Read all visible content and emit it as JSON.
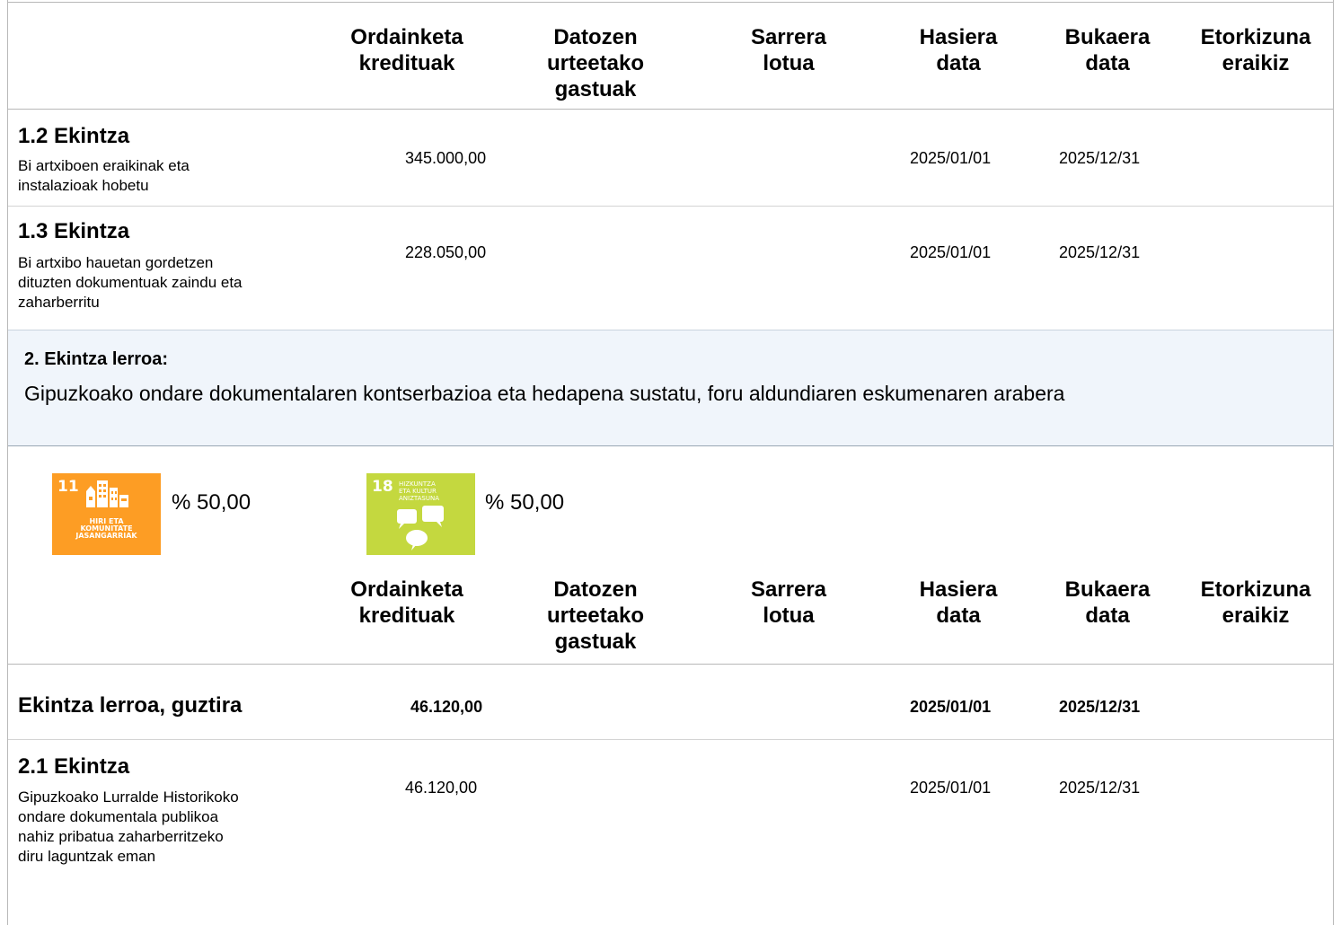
{
  "columns": [
    [
      "Ordainketa",
      "kredituak"
    ],
    [
      "Datozen",
      "urteetako",
      "gastuak"
    ],
    [
      "Sarrera",
      "lotua"
    ],
    [
      "Hasiera",
      "data"
    ],
    [
      "Bukaera",
      "data"
    ],
    [
      "Etorkizuna",
      "eraikiz"
    ]
  ],
  "rows_top": [
    {
      "title": "1.2 Ekintza",
      "desc": [
        "Bi artxiboen eraikinak eta",
        "instalazioak hobetu"
      ],
      "credit": "345.000,00",
      "start": "2025/01/01",
      "end": "2025/12/31"
    },
    {
      "title": "1.3 Ekintza",
      "desc": [
        "Bi artxibo hauetan gordetzen",
        "dituzten dokumentuak  zaindu eta",
        "zaharberritu"
      ],
      "credit": "228.050,00",
      "start": "2025/01/01",
      "end": "2025/12/31"
    }
  ],
  "section": {
    "heading": "2. Ekintza lerroa:",
    "text": "Gipuzkoako ondare dokumentalaren kontserbazioa eta hedapena sustatu, foru aldundiaren eskumenaren arabera"
  },
  "sdgs": [
    {
      "number": "11",
      "label": [
        "HIRI ETA",
        "KOMUNITATE",
        "JASANGARRIAK"
      ],
      "icon": "city-buildings-icon",
      "color": "#fd9d24",
      "percent": "% 50,00"
    },
    {
      "number": "18",
      "label": [
        "HIZKUNTZA",
        "ETA KULTUR",
        "ANIZTASUNA"
      ],
      "icon": "speech-bubbles-icon",
      "color": "#c4d83f",
      "percent": "% 50,00"
    }
  ],
  "total_row": {
    "title": "Ekintza lerroa, guztira",
    "credit": "46.120,00",
    "start": "2025/01/01",
    "end": "2025/12/31"
  },
  "rows_bottom": [
    {
      "title": "2.1 Ekintza",
      "desc": [
        "Gipuzkoako Lurralde Historikoko",
        "ondare dokumentala publikoa",
        "nahiz pribatua zaharberritzeko",
        "diru laguntzak eman"
      ],
      "credit": "46.120,00",
      "start": "2025/01/01",
      "end": "2025/12/31"
    }
  ]
}
